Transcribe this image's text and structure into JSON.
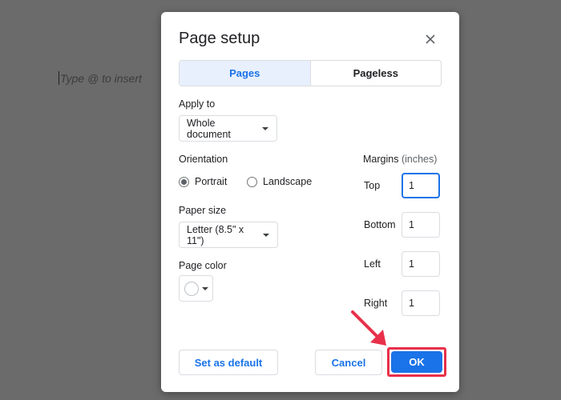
{
  "document": {
    "placeholder_hint": "Type @ to insert"
  },
  "dialog": {
    "title": "Page setup",
    "close_icon": "close-icon",
    "tabs": [
      {
        "label": "Pages",
        "active": true
      },
      {
        "label": "Pageless",
        "active": false
      }
    ],
    "apply_to": {
      "label": "Apply to",
      "value": "Whole document"
    },
    "orientation": {
      "label": "Orientation",
      "options": [
        {
          "label": "Portrait",
          "selected": true
        },
        {
          "label": "Landscape",
          "selected": false
        }
      ]
    },
    "paper_size": {
      "label": "Paper size",
      "value": "Letter (8.5\" x 11\")"
    },
    "page_color": {
      "label": "Page color",
      "value": "#ffffff"
    },
    "margins": {
      "label": "Margins",
      "unit": "(inches)",
      "fields": [
        {
          "label": "Top",
          "value": "1",
          "focused": true
        },
        {
          "label": "Bottom",
          "value": "1",
          "focused": false
        },
        {
          "label": "Left",
          "value": "1",
          "focused": false
        },
        {
          "label": "Right",
          "value": "1",
          "focused": false
        }
      ]
    },
    "buttons": {
      "set_default": "Set as default",
      "cancel": "Cancel",
      "ok": "OK"
    },
    "colors": {
      "accent": "#1a73e8",
      "annotation": "#e8304a"
    }
  }
}
